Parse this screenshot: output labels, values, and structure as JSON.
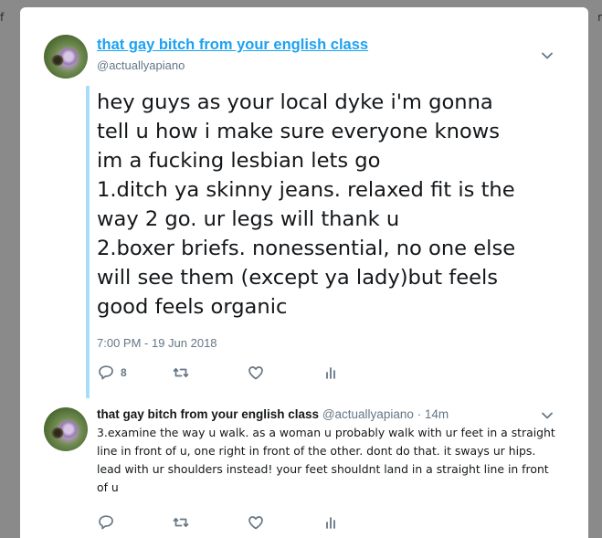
{
  "backdrop": {
    "left_fragment": "f",
    "right_fragment": "r"
  },
  "main_tweet": {
    "display_name": "that gay bitch from your english class",
    "handle": "@actuallyapiano",
    "text_lines": [
      "hey guys as your local dyke i'm gonna",
      "tell u how i make sure everyone knows",
      "im a fucking lesbian lets go",
      "1.ditch ya skinny jeans. relaxed fit is the",
      "way 2 go. ur legs will thank u",
      "2.boxer briefs. nonessential, no one else",
      "will see them (except ya lady)but feels",
      "good feels organic"
    ],
    "timestamp": "7:00 PM - 19 Jun 2018",
    "reply_count": "8",
    "icons": [
      "reply-icon",
      "retweet-icon",
      "like-icon",
      "analytics-icon",
      "chevron-down-icon"
    ]
  },
  "reply_tweet": {
    "display_name": "that gay bitch from your english class",
    "handle": "@actuallyapiano",
    "separator": " · ",
    "time_ago": "14m",
    "text_lines": [
      "3.examine the way u walk. as a woman u probably walk with ur feet in a straight",
      "line in front of u, one right in front of the other. dont do that. it sways ur hips.",
      "lead with ur shoulders instead! your feet shouldnt land in a straight line in front",
      "of u"
    ]
  },
  "colors": {
    "link_blue": "#1da1f2",
    "thread_line": "#a9dcfb",
    "muted": "#657786",
    "text": "#14171a"
  }
}
